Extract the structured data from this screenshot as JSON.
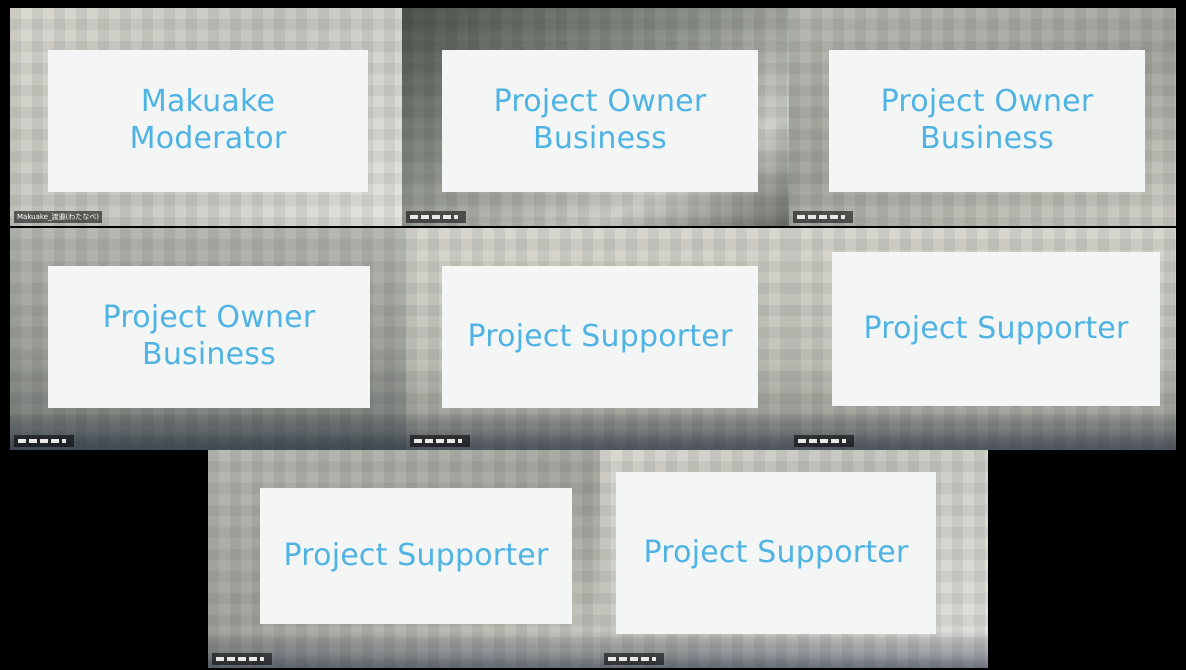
{
  "meeting": {
    "tiles": [
      {
        "id": "tile-1",
        "lines": [
          "Makuake",
          "Moderator"
        ],
        "name_tag": "Makuake_渡邉(わたなべ)"
      },
      {
        "id": "tile-2",
        "lines": [
          "Project Owner",
          "Business"
        ],
        "name_tag": ""
      },
      {
        "id": "tile-3",
        "lines": [
          "Project Owner",
          "Business"
        ],
        "name_tag": ""
      },
      {
        "id": "tile-4",
        "lines": [
          "Project Owner",
          "Business"
        ],
        "name_tag": ""
      },
      {
        "id": "tile-5",
        "lines": [
          "Project Supporter"
        ],
        "name_tag": ""
      },
      {
        "id": "tile-6",
        "lines": [
          "Project Supporter"
        ],
        "name_tag": ""
      },
      {
        "id": "tile-7",
        "lines": [
          "Project Supporter"
        ],
        "name_tag": ""
      },
      {
        "id": "tile-8",
        "lines": [
          "Project Supporter"
        ],
        "name_tag": ""
      }
    ],
    "colors": {
      "label_text": "#4fb3e3",
      "card_background": "#f4f5f5",
      "page_background": "#000000"
    }
  }
}
